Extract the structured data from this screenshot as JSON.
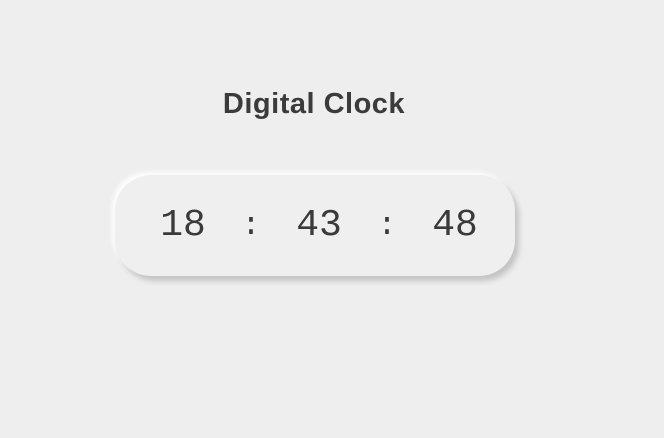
{
  "title": "Digital Clock",
  "clock": {
    "hours": "18",
    "minutes": "43",
    "seconds": "48",
    "separator": ":"
  },
  "colors": {
    "background": "#eeeeee",
    "text": "#3a3a3a"
  }
}
